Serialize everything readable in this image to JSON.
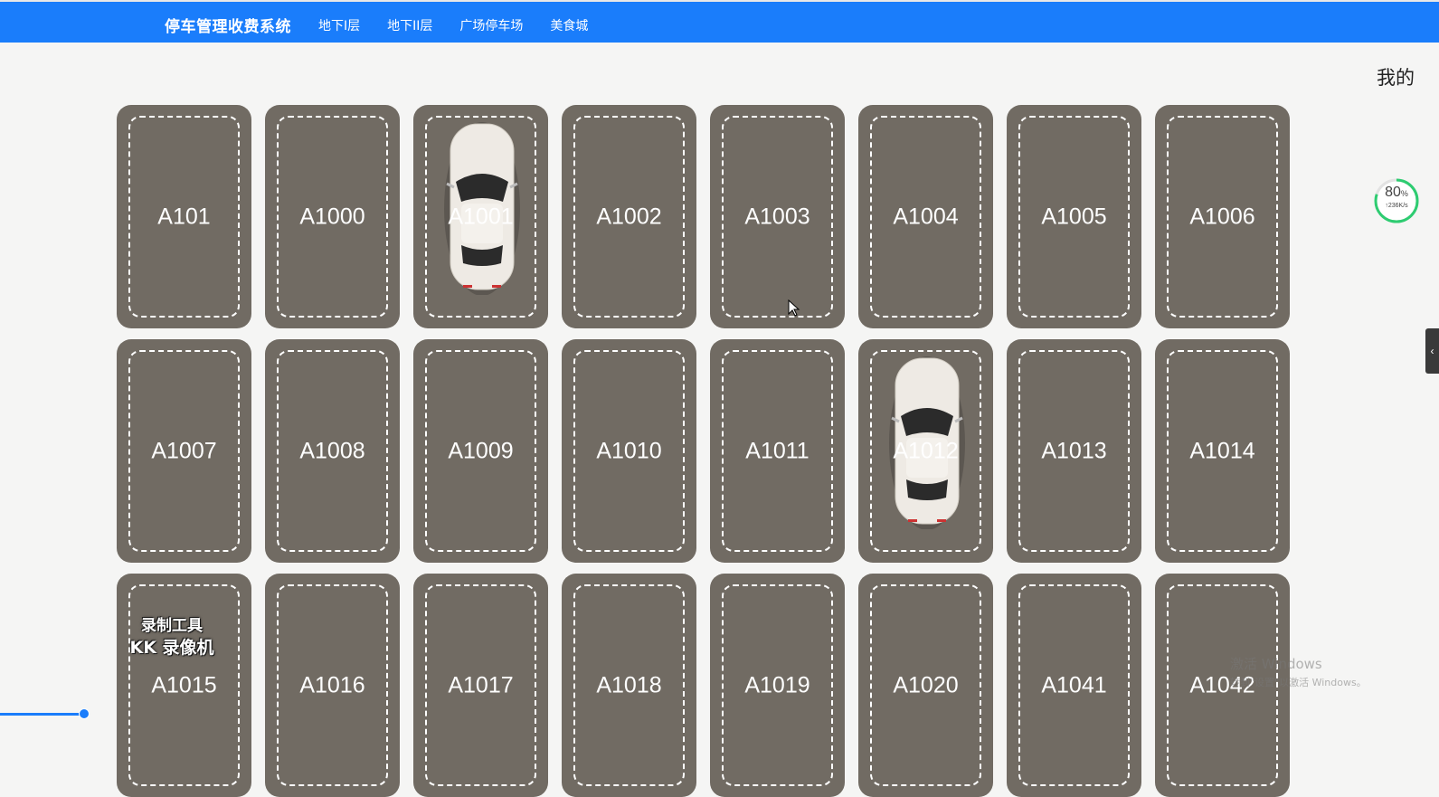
{
  "header": {
    "title": "停车管理收费系统",
    "nav": [
      "地下I层",
      "地下II层",
      "广场停车场",
      "美食城"
    ]
  },
  "user": {
    "label": "我的"
  },
  "parking": {
    "spots": [
      {
        "label": "A101",
        "occupied": false
      },
      {
        "label": "A1000",
        "occupied": false
      },
      {
        "label": "A1001",
        "occupied": true
      },
      {
        "label": "A1002",
        "occupied": false
      },
      {
        "label": "A1003",
        "occupied": false
      },
      {
        "label": "A1004",
        "occupied": false
      },
      {
        "label": "A1005",
        "occupied": false
      },
      {
        "label": "A1006",
        "occupied": false
      },
      {
        "label": "A1007",
        "occupied": false
      },
      {
        "label": "A1008",
        "occupied": false
      },
      {
        "label": "A1009",
        "occupied": false
      },
      {
        "label": "A1010",
        "occupied": false
      },
      {
        "label": "A1011",
        "occupied": false
      },
      {
        "label": "A1012",
        "occupied": true
      },
      {
        "label": "A1013",
        "occupied": false
      },
      {
        "label": "A1014",
        "occupied": false
      },
      {
        "label": "A1015",
        "occupied": false
      },
      {
        "label": "A1016",
        "occupied": false
      },
      {
        "label": "A1017",
        "occupied": false
      },
      {
        "label": "A1018",
        "occupied": false
      },
      {
        "label": "A1019",
        "occupied": false
      },
      {
        "label": "A1020",
        "occupied": false
      },
      {
        "label": "A1041",
        "occupied": false
      },
      {
        "label": "A1042",
        "occupied": false
      }
    ]
  },
  "speed_widget": {
    "percent": "80",
    "percent_unit": "%",
    "rate": "↑236K/s",
    "level": 0.8
  },
  "watermark": {
    "line1": "录制工具",
    "line2": "KK 录像机"
  },
  "activation": {
    "line1": "激活 Windows",
    "line2": "转到\"设置\"以激活 Windows。"
  },
  "colors": {
    "header_bg": "#1a7dfb",
    "spot_bg": "#716b63",
    "spot_line": "#ffffff",
    "speed_ring": "#2ecc71"
  }
}
